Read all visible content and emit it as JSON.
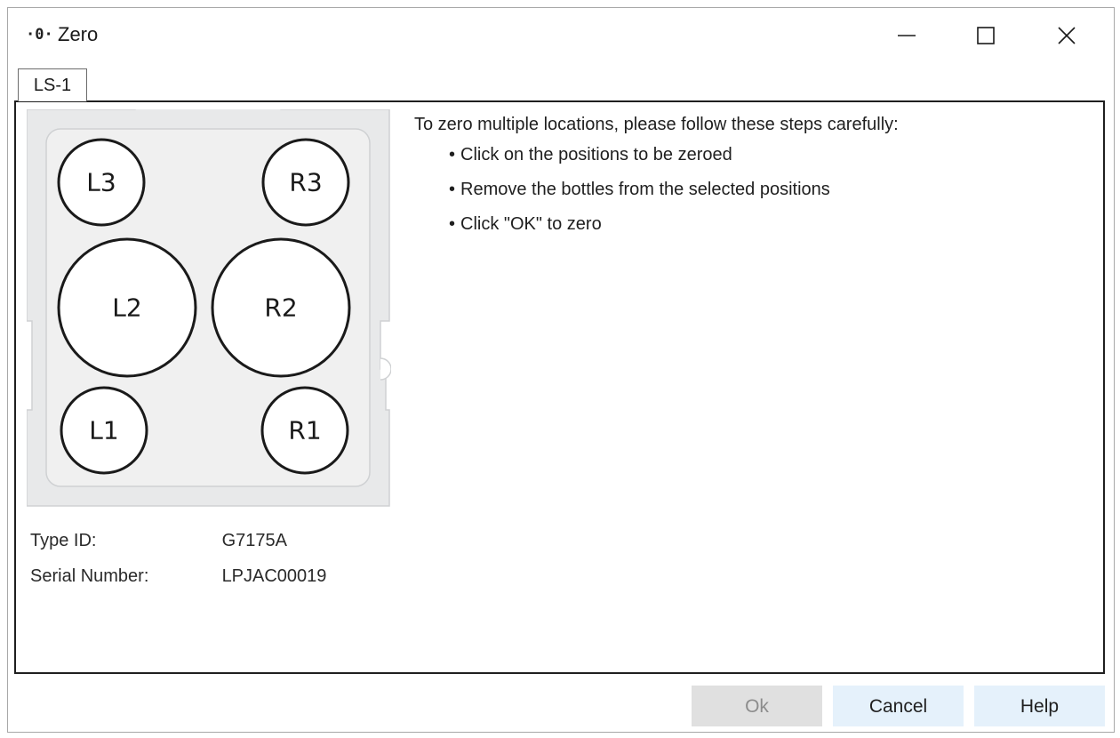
{
  "window": {
    "title": "Zero",
    "title_icon": "·0·"
  },
  "tabs": [
    {
      "label": "LS-1",
      "active": true
    }
  ],
  "tray": {
    "positions": [
      {
        "id": "L3",
        "label": "L3",
        "size": "small"
      },
      {
        "id": "R3",
        "label": "R3",
        "size": "small"
      },
      {
        "id": "L2",
        "label": "L2",
        "size": "large"
      },
      {
        "id": "R2",
        "label": "R2",
        "size": "large"
      },
      {
        "id": "L1",
        "label": "L1",
        "size": "small"
      },
      {
        "id": "R1",
        "label": "R1",
        "size": "small"
      }
    ]
  },
  "instructions": {
    "title": "To zero multiple locations, please follow these steps carefully:",
    "steps": [
      "Click on the positions to be zeroed",
      "Remove the bottles from the selected positions",
      "Click \"OK\" to zero"
    ]
  },
  "info": {
    "type_id_label": "Type ID:",
    "type_id_value": "G7175A",
    "serial_label": "Serial Number:",
    "serial_value": "LPJAC00019"
  },
  "buttons": {
    "ok": {
      "label": "Ok",
      "enabled": false
    },
    "cancel": {
      "label": "Cancel",
      "enabled": true
    },
    "help": {
      "label": "Help",
      "enabled": true
    }
  },
  "colors": {
    "tray_outer": "#e8e9ea",
    "tray_inner": "#f0f0f0",
    "button_bg": "#e5f1fb",
    "button_disabled_bg": "#e0e0e0"
  }
}
